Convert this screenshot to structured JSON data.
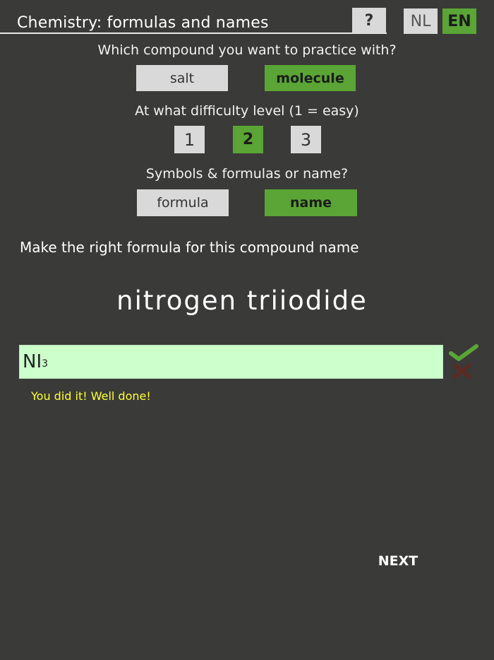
{
  "header": {
    "title": "Chemistry: formulas and names",
    "help_label": "?",
    "lang_nl_label": "NL",
    "lang_en_label": "EN",
    "active_language": "EN"
  },
  "compound_type": {
    "question": "Which compound you want to practice with?",
    "options": [
      "salt",
      "molecule"
    ],
    "selected": "molecule"
  },
  "difficulty": {
    "question": "At what difficulty level (1 = easy)",
    "options": [
      "1",
      "2",
      "3"
    ],
    "selected": "2"
  },
  "mode": {
    "question": "Symbols & formulas or name?",
    "options": [
      "formula",
      "name"
    ],
    "selected": "name"
  },
  "exercise": {
    "instruction": "Make the right formula for this compound name",
    "compound_name": "nitrogen triiodide",
    "answer_main": "NI",
    "answer_subscript": "3",
    "feedback": "You did it! Well done!",
    "result": "correct"
  },
  "footer": {
    "next_label": "NEXT"
  },
  "colors": {
    "background": "#3a3a38",
    "selected_green": "#5aa535",
    "unselected_gray": "#d9d9d9",
    "answer_box": "#ccffcc",
    "feedback_yellow": "#ffff33",
    "check_green": "#5aa535",
    "cross_dark_red": "#5c2a22"
  },
  "icons": {
    "correct": "check-icon",
    "incorrect": "cross-icon"
  }
}
